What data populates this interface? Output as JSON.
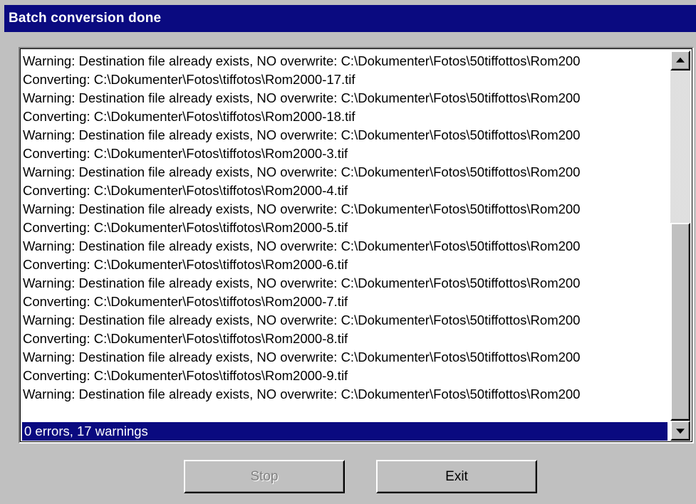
{
  "window": {
    "title": "Batch conversion done"
  },
  "log": {
    "lines": [
      "Warning: Destination file already exists, NO overwrite: C:\\Dokumenter\\Fotos\\50tiffottos\\Rom200",
      "Converting: C:\\Dokumenter\\Fotos\\tiffotos\\Rom2000-17.tif",
      "Warning: Destination file already exists, NO overwrite: C:\\Dokumenter\\Fotos\\50tiffottos\\Rom200",
      "Converting: C:\\Dokumenter\\Fotos\\tiffotos\\Rom2000-18.tif",
      "Warning: Destination file already exists, NO overwrite: C:\\Dokumenter\\Fotos\\50tiffottos\\Rom200",
      "Converting: C:\\Dokumenter\\Fotos\\tiffotos\\Rom2000-3.tif",
      "Warning: Destination file already exists, NO overwrite: C:\\Dokumenter\\Fotos\\50tiffottos\\Rom200",
      "Converting: C:\\Dokumenter\\Fotos\\tiffotos\\Rom2000-4.tif",
      "Warning: Destination file already exists, NO overwrite: C:\\Dokumenter\\Fotos\\50tiffottos\\Rom200",
      "Converting: C:\\Dokumenter\\Fotos\\tiffotos\\Rom2000-5.tif",
      "Warning: Destination file already exists, NO overwrite: C:\\Dokumenter\\Fotos\\50tiffottos\\Rom200",
      "Converting: C:\\Dokumenter\\Fotos\\tiffotos\\Rom2000-6.tif",
      "Warning: Destination file already exists, NO overwrite: C:\\Dokumenter\\Fotos\\50tiffottos\\Rom200",
      "Converting: C:\\Dokumenter\\Fotos\\tiffotos\\Rom2000-7.tif",
      "Warning: Destination file already exists, NO overwrite: C:\\Dokumenter\\Fotos\\50tiffottos\\Rom200",
      "Converting: C:\\Dokumenter\\Fotos\\tiffotos\\Rom2000-8.tif",
      "Warning: Destination file already exists, NO overwrite: C:\\Dokumenter\\Fotos\\50tiffottos\\Rom200",
      "Converting: C:\\Dokumenter\\Fotos\\tiffotos\\Rom2000-9.tif",
      "Warning: Destination file already exists, NO overwrite: C:\\Dokumenter\\Fotos\\50tiffottos\\Rom200",
      ""
    ],
    "selected_line": "0 errors, 17 warnings"
  },
  "scrollbar": {
    "up_icon": "scroll-up-arrow",
    "down_icon": "scroll-down-arrow"
  },
  "buttons": {
    "stop_label": "Stop",
    "exit_label": "Exit"
  },
  "colors": {
    "titlebar": "#0a0a80",
    "face": "#c0c0c0",
    "selection": "#0a0a80"
  }
}
